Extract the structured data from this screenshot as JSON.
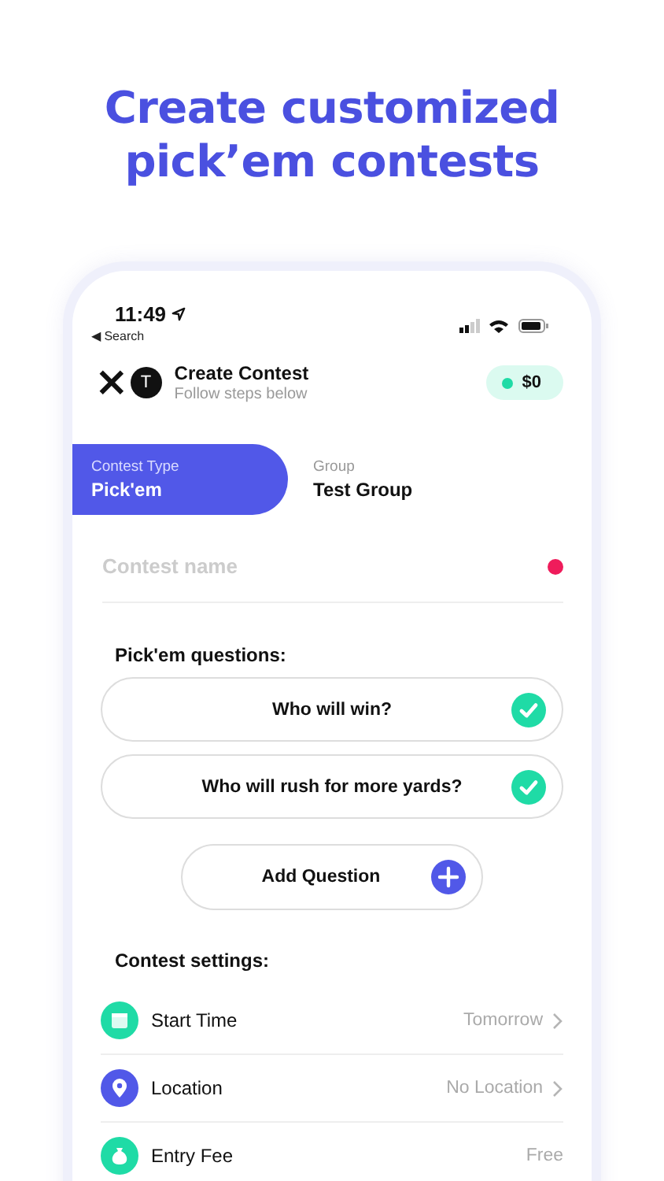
{
  "headline": "Create customized pick’em contests",
  "status_bar": {
    "time": "11:49",
    "back": "◀ Search"
  },
  "header": {
    "close": "×",
    "avatar": "T",
    "title": "Create Contest",
    "subtitle": "Follow steps below",
    "balance": "$0"
  },
  "tabs": [
    {
      "label": "Contest Type",
      "value": "Pick'em",
      "selected": true
    },
    {
      "label": "Group",
      "value": "Test Group",
      "selected": false
    }
  ],
  "contest_name": {
    "placeholder": "Contest name",
    "required": true
  },
  "questions": {
    "title": "Pick'em questions:",
    "items": [
      {
        "text": "Who will win?",
        "checked": true
      },
      {
        "text": "Who will rush for more yards?",
        "checked": true
      }
    ],
    "add": "Add Question"
  },
  "settings": {
    "title": "Contest settings:",
    "items": [
      {
        "kind": "calendar",
        "color": "#1fdba6",
        "label": "Start Time",
        "value": "Tomorrow",
        "chevron": true
      },
      {
        "kind": "location",
        "color": "#5158e8",
        "label": "Location",
        "value": "No Location",
        "chevron": true
      },
      {
        "kind": "fee",
        "color": "#1fdba6",
        "label": "Entry Fee",
        "value": "Free",
        "chevron": false
      }
    ]
  }
}
